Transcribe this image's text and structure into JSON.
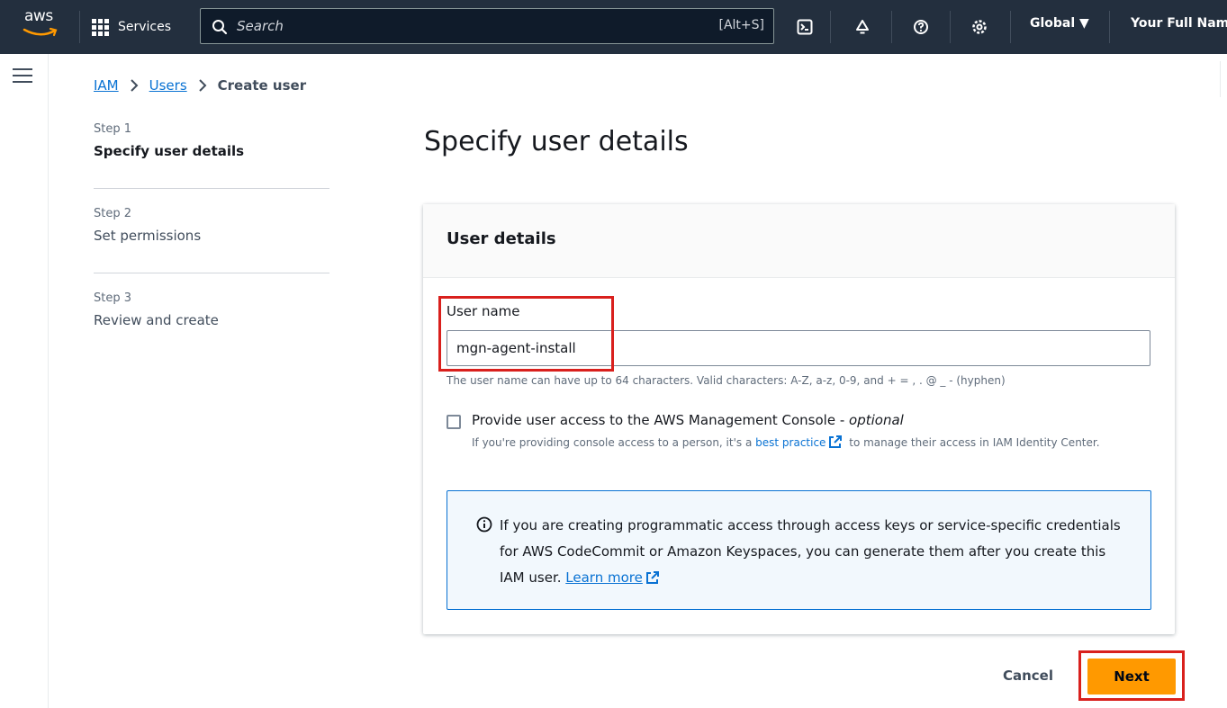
{
  "topbar": {
    "logo_text": "aws",
    "services_label": "Services",
    "search_placeholder": "Search",
    "search_shortcut": "[Alt+S]",
    "region_label": "Global ▼",
    "account_name": "Your Full Name",
    "icons": [
      "cloudshell-icon",
      "bell-icon",
      "help-icon",
      "settings-icon"
    ]
  },
  "breadcrumb": {
    "items": [
      "IAM",
      "Users"
    ],
    "current": "Create user"
  },
  "steps": [
    {
      "label": "Step 1",
      "title": "Specify user details",
      "active": true
    },
    {
      "label": "Step 2",
      "title": "Set permissions",
      "active": false
    },
    {
      "label": "Step 3",
      "title": "Review and create",
      "active": false
    }
  ],
  "page_title": "Specify user details",
  "panel": {
    "title": "User details",
    "user_name_label": "User name",
    "user_name_value": "mgn-agent-install",
    "user_name_hint": "The user name can have up to 64 characters. Valid characters: A-Z, a-z, 0-9, and + = , . @ _ - (hyphen)",
    "console_access": {
      "label": "Provide user access to the AWS Management Console - ",
      "label_optional": "optional",
      "checked": false,
      "desc_before": "If you're providing console access to a person, it's a ",
      "desc_link": "best practice",
      "desc_after": " to manage their access in IAM Identity Center."
    },
    "info": {
      "text": "If you are creating programmatic access through access keys or service-specific credentials for AWS CodeCommit or Amazon Keyspaces, you can generate them after you create this IAM user. ",
      "link": "Learn more"
    }
  },
  "footer": {
    "cancel_label": "Cancel",
    "next_label": "Next"
  },
  "colors": {
    "nav_bg": "#232f3e",
    "link": "#0972d3",
    "primary_button": "#ff9900",
    "highlight": "#d9201d"
  }
}
